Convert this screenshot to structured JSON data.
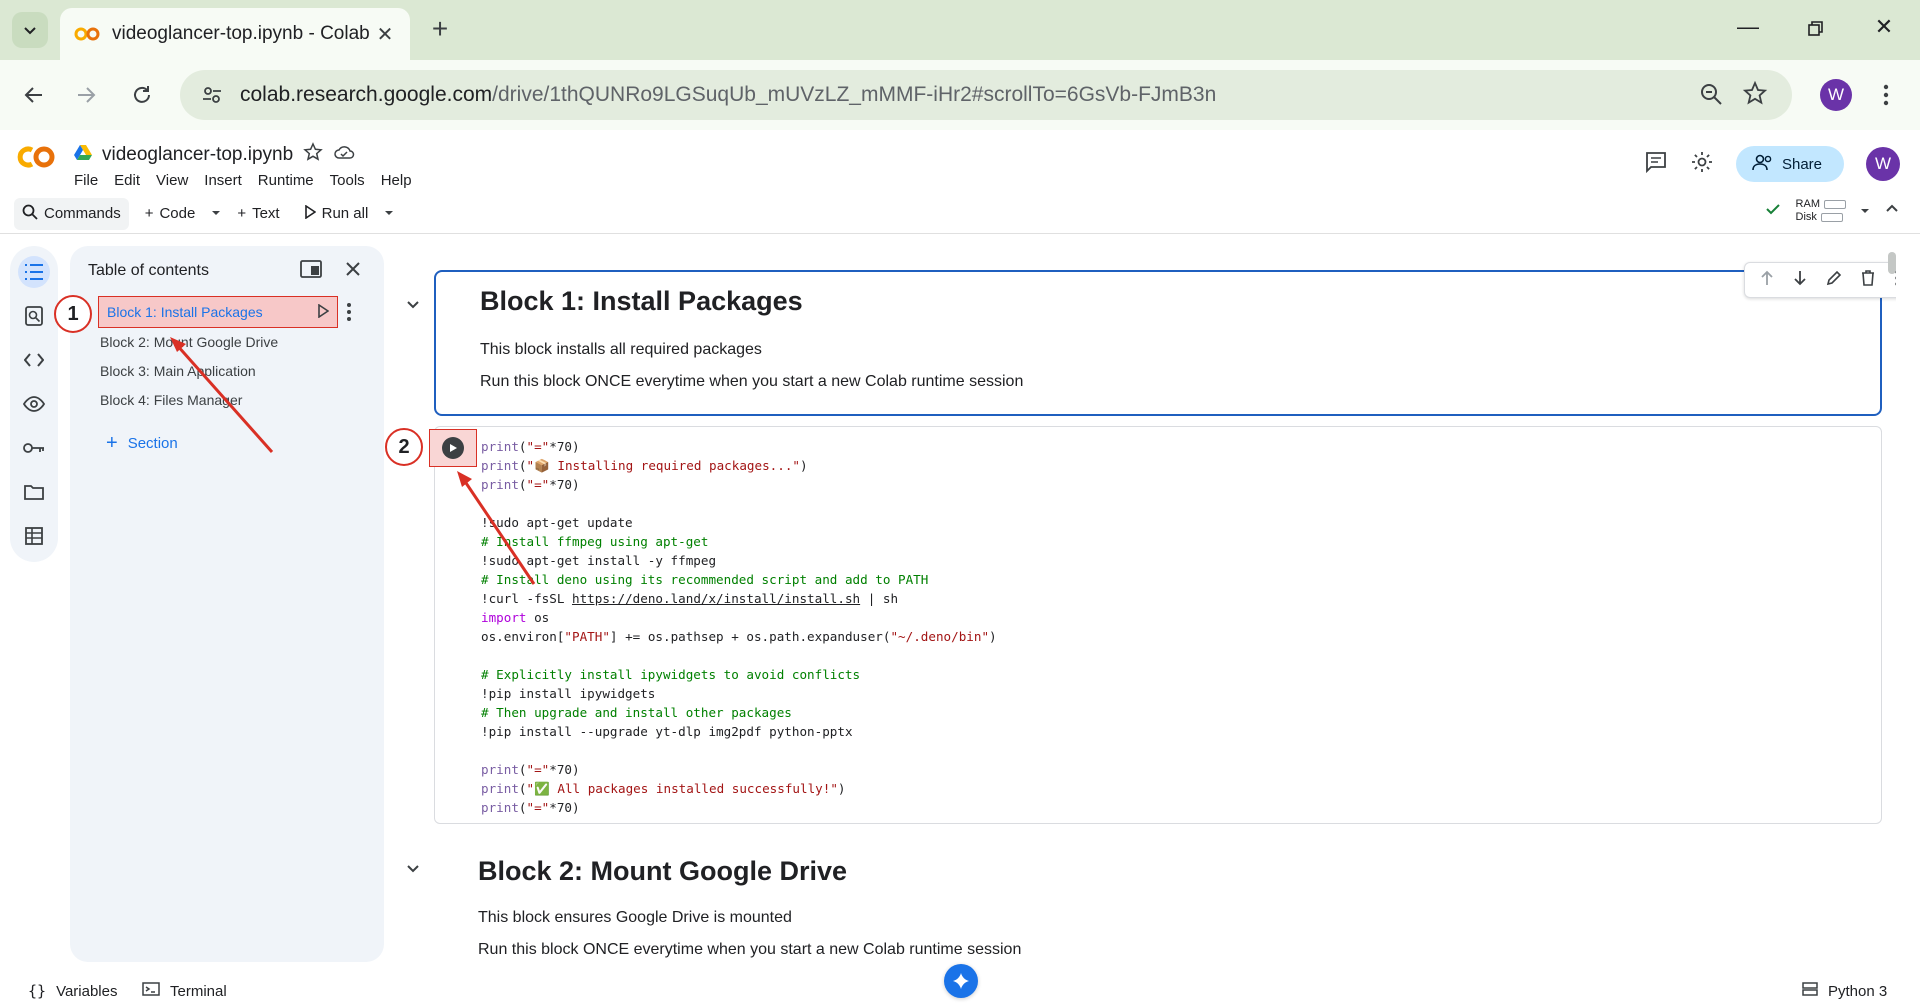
{
  "browser": {
    "tab_title": "videoglancer-top.ipynb - Colab",
    "url_host": "colab.research.google.com",
    "url_path": "/drive/1thQUNRo9LGSuqUb_mUVzLZ_mMMF-iHr2#scrollTo=6GsVb-FJmB3n",
    "profile_initial": "W"
  },
  "colab": {
    "doc_title": "videoglancer-top.ipynb",
    "menu": [
      "File",
      "Edit",
      "View",
      "Insert",
      "Runtime",
      "Tools",
      "Help"
    ],
    "share_label": "Share",
    "avatar_initial": "W",
    "toolbar": {
      "commands": "Commands",
      "code": "Code",
      "text": "Text",
      "run_all": "Run all",
      "ram": "RAM",
      "disk": "Disk"
    }
  },
  "toc": {
    "title": "Table of contents",
    "items": [
      "Block 1: Install Packages",
      "Block 2: Mount Google Drive",
      "Block 3: Main Application",
      "Block 4: Files Manager"
    ],
    "add_section": "Section"
  },
  "annotations": {
    "badge1": "1",
    "badge2": "2"
  },
  "notebook": {
    "block1": {
      "heading": "Block 1: Install Packages",
      "line1": "This block installs all required packages",
      "line2": "Run this block ONCE everytime when you start a new Colab runtime session"
    },
    "code_lines": [
      "print(\"=\"*70)",
      "print(\"📦 Installing required packages...\")",
      "print(\"=\"*70)",
      "",
      "!sudo apt-get update",
      "# Install ffmpeg using apt-get",
      "!sudo apt-get install -y ffmpeg",
      "# Install deno using its recommended script and add to PATH",
      "!curl -fsSL https://deno.land/x/install/install.sh | sh",
      "import os",
      "os.environ[\"PATH\"] += os.pathsep + os.path.expanduser(\"~/.deno/bin\")",
      "",
      "# Explicitly install ipywidgets to avoid conflicts",
      "!pip install ipywidgets",
      "# Then upgrade and install other packages",
      "!pip install --upgrade yt-dlp img2pdf python-pptx",
      "",
      "print(\"=\"*70)",
      "print(\"✅ All packages installed successfully!\")",
      "print(\"=\"*70)"
    ],
    "block2": {
      "heading": "Block 2: Mount Google Drive",
      "line1": "This block ensures Google Drive is mounted",
      "line2": "Run this block ONCE everytime when you start a new Colab runtime session"
    }
  },
  "bottom": {
    "variables": "Variables",
    "terminal": "Terminal",
    "runtime": "Python 3"
  },
  "colors": {
    "accent": "#1a73e8",
    "annotation_red": "#d93025",
    "cell_border_selected": "#1f5fbf"
  }
}
